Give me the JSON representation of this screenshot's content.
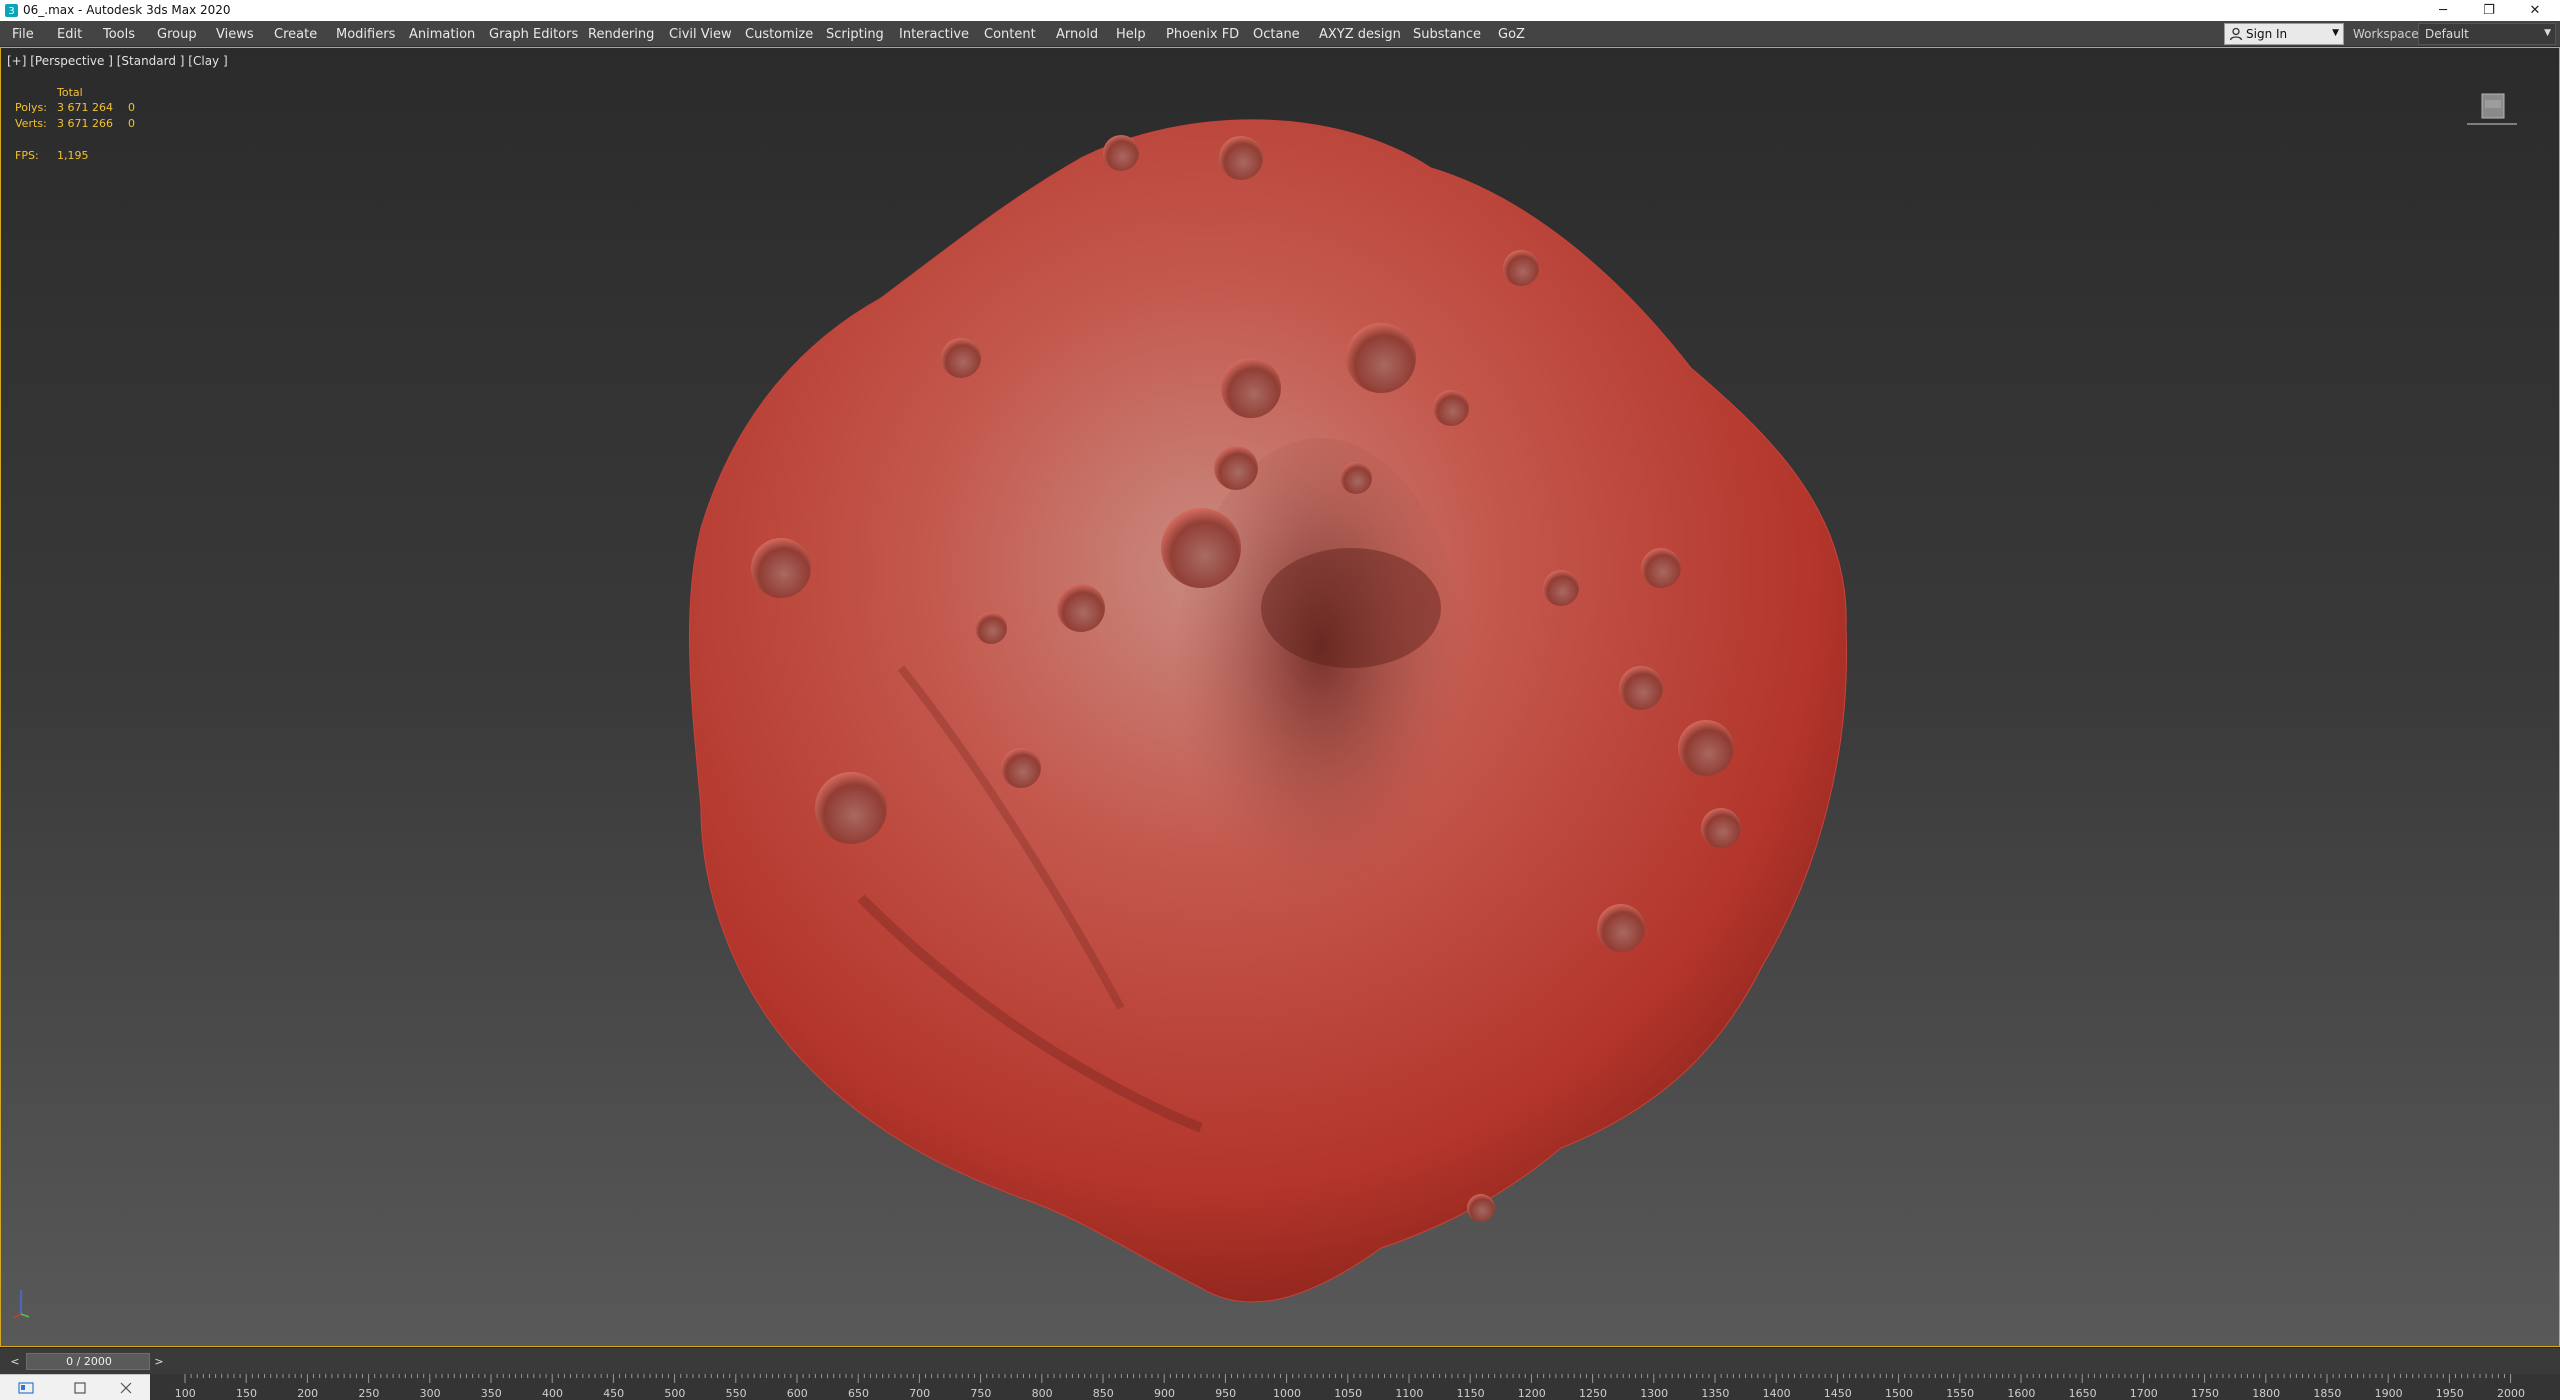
{
  "window": {
    "title": "06_.max - Autodesk 3ds Max 2020",
    "controls": {
      "minimize": "─",
      "maximize": "❐",
      "close": "✕"
    }
  },
  "menu": {
    "items": [
      {
        "label": "File"
      },
      {
        "label": "Edit"
      },
      {
        "label": "Tools"
      },
      {
        "label": "Group"
      },
      {
        "label": "Views"
      },
      {
        "label": "Create"
      },
      {
        "label": "Modifiers"
      },
      {
        "label": "Animation"
      },
      {
        "label": "Graph Editors"
      },
      {
        "label": "Rendering"
      },
      {
        "label": "Civil View"
      },
      {
        "label": "Customize"
      },
      {
        "label": "Scripting"
      },
      {
        "label": "Interactive"
      },
      {
        "label": "Content"
      },
      {
        "label": "Arnold"
      },
      {
        "label": "Help"
      },
      {
        "label": "Phoenix FD"
      },
      {
        "label": "Octane"
      },
      {
        "label": "AXYZ design"
      },
      {
        "label": "Substance"
      },
      {
        "label": "GoZ"
      }
    ],
    "sign_in": "Sign In",
    "workspaces_label": "Workspaces:",
    "workspaces_value": "Default"
  },
  "viewport": {
    "label": "[+] [Perspective ] [Standard ] [Clay ]",
    "stats": {
      "total_header": "Total",
      "polys_label": "Polys:",
      "polys_value": "3 671 264",
      "polys_selected": "0",
      "verts_label": "Verts:",
      "verts_value": "3 671 266",
      "verts_selected": "0",
      "fps_label": "FPS:",
      "fps_value": "1,195"
    },
    "object_color": "#c8433a"
  },
  "timeline": {
    "prev": "<",
    "next": ">",
    "slider_text": "0 / 2000",
    "ruler_labels": [
      "100",
      "150",
      "200",
      "250",
      "300",
      "350",
      "400",
      "450",
      "500",
      "550",
      "600",
      "650",
      "700",
      "750",
      "800",
      "850",
      "900",
      "950",
      "1000",
      "1050",
      "1100",
      "1150",
      "1200",
      "1250",
      "1300",
      "1350",
      "1400",
      "1450",
      "1500",
      "1550",
      "1600",
      "1650",
      "1700",
      "1750",
      "1800",
      "1850",
      "1900",
      "1950",
      "2000"
    ]
  },
  "taskbar": {
    "icons": [
      "app-window-icon",
      "square-icon",
      "close-x-icon"
    ]
  }
}
